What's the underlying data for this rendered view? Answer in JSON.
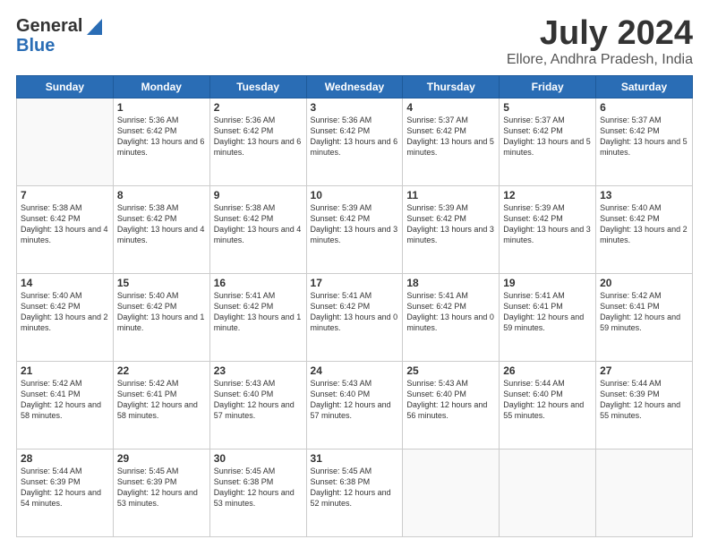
{
  "header": {
    "logo_general": "General",
    "logo_blue": "Blue",
    "title": "July 2024",
    "location": "Ellore, Andhra Pradesh, India"
  },
  "days_of_week": [
    "Sunday",
    "Monday",
    "Tuesday",
    "Wednesday",
    "Thursday",
    "Friday",
    "Saturday"
  ],
  "weeks": [
    [
      {
        "day": "",
        "info": ""
      },
      {
        "day": "1",
        "info": "Sunrise: 5:36 AM\nSunset: 6:42 PM\nDaylight: 13 hours\nand 6 minutes."
      },
      {
        "day": "2",
        "info": "Sunrise: 5:36 AM\nSunset: 6:42 PM\nDaylight: 13 hours\nand 6 minutes."
      },
      {
        "day": "3",
        "info": "Sunrise: 5:36 AM\nSunset: 6:42 PM\nDaylight: 13 hours\nand 6 minutes."
      },
      {
        "day": "4",
        "info": "Sunrise: 5:37 AM\nSunset: 6:42 PM\nDaylight: 13 hours\nand 5 minutes."
      },
      {
        "day": "5",
        "info": "Sunrise: 5:37 AM\nSunset: 6:42 PM\nDaylight: 13 hours\nand 5 minutes."
      },
      {
        "day": "6",
        "info": "Sunrise: 5:37 AM\nSunset: 6:42 PM\nDaylight: 13 hours\nand 5 minutes."
      }
    ],
    [
      {
        "day": "7",
        "info": "Sunrise: 5:38 AM\nSunset: 6:42 PM\nDaylight: 13 hours\nand 4 minutes."
      },
      {
        "day": "8",
        "info": "Sunrise: 5:38 AM\nSunset: 6:42 PM\nDaylight: 13 hours\nand 4 minutes."
      },
      {
        "day": "9",
        "info": "Sunrise: 5:38 AM\nSunset: 6:42 PM\nDaylight: 13 hours\nand 4 minutes."
      },
      {
        "day": "10",
        "info": "Sunrise: 5:39 AM\nSunset: 6:42 PM\nDaylight: 13 hours\nand 3 minutes."
      },
      {
        "day": "11",
        "info": "Sunrise: 5:39 AM\nSunset: 6:42 PM\nDaylight: 13 hours\nand 3 minutes."
      },
      {
        "day": "12",
        "info": "Sunrise: 5:39 AM\nSunset: 6:42 PM\nDaylight: 13 hours\nand 3 minutes."
      },
      {
        "day": "13",
        "info": "Sunrise: 5:40 AM\nSunset: 6:42 PM\nDaylight: 13 hours\nand 2 minutes."
      }
    ],
    [
      {
        "day": "14",
        "info": "Sunrise: 5:40 AM\nSunset: 6:42 PM\nDaylight: 13 hours\nand 2 minutes."
      },
      {
        "day": "15",
        "info": "Sunrise: 5:40 AM\nSunset: 6:42 PM\nDaylight: 13 hours\nand 1 minute."
      },
      {
        "day": "16",
        "info": "Sunrise: 5:41 AM\nSunset: 6:42 PM\nDaylight: 13 hours\nand 1 minute."
      },
      {
        "day": "17",
        "info": "Sunrise: 5:41 AM\nSunset: 6:42 PM\nDaylight: 13 hours\nand 0 minutes."
      },
      {
        "day": "18",
        "info": "Sunrise: 5:41 AM\nSunset: 6:42 PM\nDaylight: 13 hours\nand 0 minutes."
      },
      {
        "day": "19",
        "info": "Sunrise: 5:41 AM\nSunset: 6:41 PM\nDaylight: 12 hours\nand 59 minutes."
      },
      {
        "day": "20",
        "info": "Sunrise: 5:42 AM\nSunset: 6:41 PM\nDaylight: 12 hours\nand 59 minutes."
      }
    ],
    [
      {
        "day": "21",
        "info": "Sunrise: 5:42 AM\nSunset: 6:41 PM\nDaylight: 12 hours\nand 58 minutes."
      },
      {
        "day": "22",
        "info": "Sunrise: 5:42 AM\nSunset: 6:41 PM\nDaylight: 12 hours\nand 58 minutes."
      },
      {
        "day": "23",
        "info": "Sunrise: 5:43 AM\nSunset: 6:40 PM\nDaylight: 12 hours\nand 57 minutes."
      },
      {
        "day": "24",
        "info": "Sunrise: 5:43 AM\nSunset: 6:40 PM\nDaylight: 12 hours\nand 57 minutes."
      },
      {
        "day": "25",
        "info": "Sunrise: 5:43 AM\nSunset: 6:40 PM\nDaylight: 12 hours\nand 56 minutes."
      },
      {
        "day": "26",
        "info": "Sunrise: 5:44 AM\nSunset: 6:40 PM\nDaylight: 12 hours\nand 55 minutes."
      },
      {
        "day": "27",
        "info": "Sunrise: 5:44 AM\nSunset: 6:39 PM\nDaylight: 12 hours\nand 55 minutes."
      }
    ],
    [
      {
        "day": "28",
        "info": "Sunrise: 5:44 AM\nSunset: 6:39 PM\nDaylight: 12 hours\nand 54 minutes."
      },
      {
        "day": "29",
        "info": "Sunrise: 5:45 AM\nSunset: 6:39 PM\nDaylight: 12 hours\nand 53 minutes."
      },
      {
        "day": "30",
        "info": "Sunrise: 5:45 AM\nSunset: 6:38 PM\nDaylight: 12 hours\nand 53 minutes."
      },
      {
        "day": "31",
        "info": "Sunrise: 5:45 AM\nSunset: 6:38 PM\nDaylight: 12 hours\nand 52 minutes."
      },
      {
        "day": "",
        "info": ""
      },
      {
        "day": "",
        "info": ""
      },
      {
        "day": "",
        "info": ""
      }
    ]
  ]
}
